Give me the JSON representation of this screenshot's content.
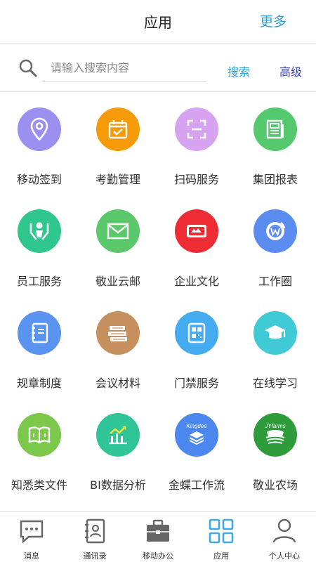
{
  "header": {
    "title": "应用",
    "more": "更多"
  },
  "search": {
    "placeholder": "请输入搜索内容",
    "button": "搜索",
    "advanced": "高级"
  },
  "apps": [
    {
      "label": "移动签到",
      "icon": "location-pin-icon",
      "color": "#9b8ff0"
    },
    {
      "label": "考勤管理",
      "icon": "calendar-check-icon",
      "color": "#f59b0a"
    },
    {
      "label": "扫码服务",
      "icon": "scan-frame-icon",
      "color": "#d7a3f0"
    },
    {
      "label": "集团报表",
      "icon": "report-document-icon",
      "color": "#55c96d"
    },
    {
      "label": "员工服务",
      "icon": "hands-person-icon",
      "color": "#2fc78d"
    },
    {
      "label": "敬业云邮",
      "icon": "envelope-icon",
      "color": "#5bc96b"
    },
    {
      "label": "企业文化",
      "icon": "culture-badge-icon",
      "color": "#ee2c34"
    },
    {
      "label": "工作圈",
      "icon": "circle-w-icon",
      "color": "#5b8df0"
    },
    {
      "label": "规章制度",
      "icon": "notebook-icon",
      "color": "#5b93f0"
    },
    {
      "label": "会议材料",
      "icon": "book-stack-icon",
      "color": "#c58f5e"
    },
    {
      "label": "门禁服务",
      "icon": "qr-card-icon",
      "color": "#45abf0"
    },
    {
      "label": "在线学习",
      "icon": "graduation-cap-icon",
      "color": "#3fcad6"
    },
    {
      "label": "知悉类文件",
      "icon": "open-book-icon",
      "color": "#7cc84a"
    },
    {
      "label": "BI数据分析",
      "icon": "growth-chart-icon",
      "color": "#2fc596"
    },
    {
      "label": "金蝶工作流",
      "icon": "kingdee-layers-icon",
      "color": "#4c87f0",
      "logo_text": "Kingdee"
    },
    {
      "label": "敬业农场",
      "icon": "farm-field-icon",
      "color": "#2f9c3c",
      "logo_text": "JYfarms"
    }
  ],
  "tabs": [
    {
      "label": "消息",
      "icon": "chat-bubble-icon"
    },
    {
      "label": "通讯录",
      "icon": "contacts-book-icon"
    },
    {
      "label": "移动办公",
      "icon": "briefcase-icon"
    },
    {
      "label": "应用",
      "icon": "apps-grid-icon",
      "active": true
    },
    {
      "label": "个人中心",
      "icon": "person-icon"
    }
  ],
  "colors": {
    "accent": "#2a9fd6",
    "advanced": "#3f4ab0",
    "tab_active": "#3fa9e6",
    "tab_inactive": "#666666"
  }
}
